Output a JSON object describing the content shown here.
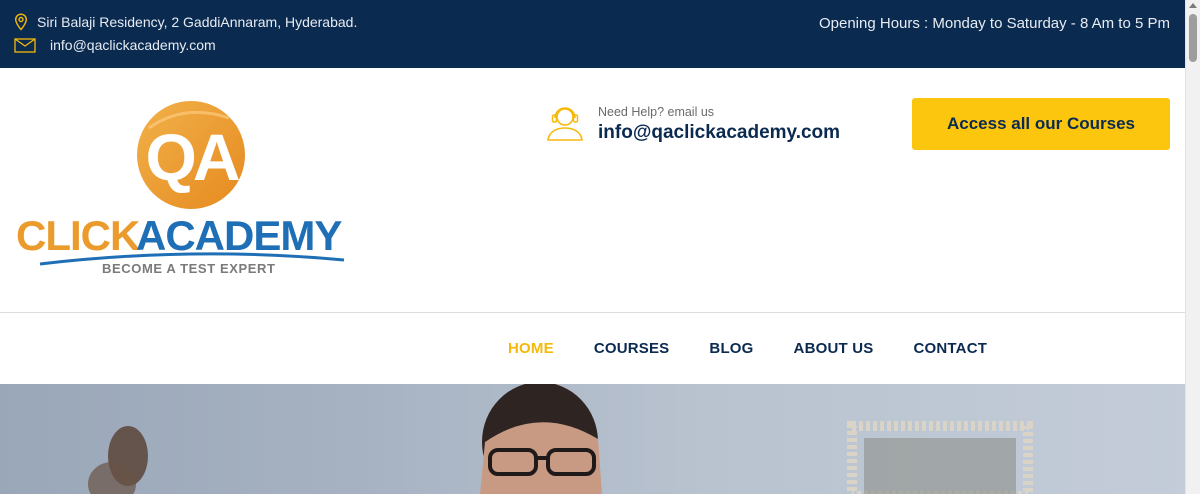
{
  "topbar": {
    "address": "Siri Balaji Residency, 2 GaddiAnnaram, Hyderabad.",
    "email": "info@qaclickacademy.com",
    "hours": "Opening Hours : Monday to Saturday - 8 Am to 5 Pm",
    "icons": {
      "address": "map-pin-icon",
      "email": "envelope-icon"
    }
  },
  "header": {
    "logo": {
      "monogram": "QA",
      "brand_part1": "CLICK",
      "brand_part2": "ACADEMY",
      "tagline": "BECOME A TEST EXPERT"
    },
    "help": {
      "label": "Need Help? email us",
      "email": "info@qaclickacademy.com",
      "icon": "support-agent-icon"
    },
    "cta_label": "Access all our Courses"
  },
  "nav": {
    "items": [
      {
        "label": "HOME",
        "active": true
      },
      {
        "label": "COURSES",
        "active": false
      },
      {
        "label": "BLOG",
        "active": false
      },
      {
        "label": "ABOUT US",
        "active": false
      },
      {
        "label": "CONTACT",
        "active": false
      }
    ]
  },
  "colors": {
    "topbar_bg": "#0b2a4f",
    "accent": "#fcc60f",
    "nav_active": "#f5b90a",
    "navy_text": "#0b2a4f",
    "logo_orange": "#eb9a2c",
    "logo_blue": "#1f6fb6"
  }
}
